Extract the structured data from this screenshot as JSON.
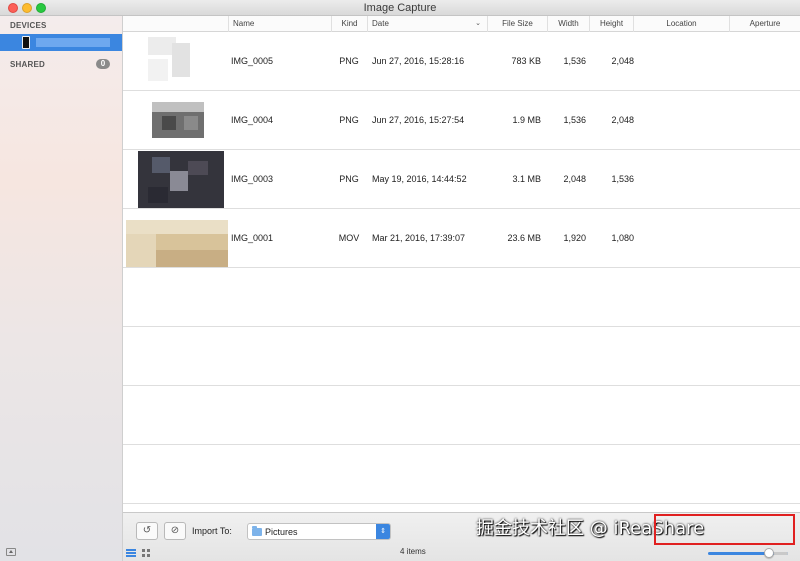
{
  "window": {
    "title": "Image Capture"
  },
  "sidebar": {
    "devices_label": "DEVICES",
    "shared_label": "SHARED",
    "shared_count": "0"
  },
  "columns": [
    "Name",
    "Kind",
    "Date",
    "File Size",
    "Width",
    "Height",
    "Location",
    "Aperture"
  ],
  "rows": [
    {
      "name": "IMG_0005",
      "kind": "PNG",
      "date": "Jun 27, 2016, 15:28:16",
      "size": "783 KB",
      "width": "1,536",
      "height": "2,048"
    },
    {
      "name": "IMG_0004",
      "kind": "PNG",
      "date": "Jun 27, 2016, 15:27:54",
      "size": "1.9 MB",
      "width": "1,536",
      "height": "2,048"
    },
    {
      "name": "IMG_0003",
      "kind": "PNG",
      "date": "May 19, 2016, 14:44:52",
      "size": "3.1 MB",
      "width": "2,048",
      "height": "1,536"
    },
    {
      "name": "IMG_0001",
      "kind": "MOV",
      "date": "Mar 21, 2016, 17:39:07",
      "size": "23.6 MB",
      "width": "1,920",
      "height": "1,080"
    }
  ],
  "toolbar": {
    "import_label": "Import To:",
    "import_value": "Pictures",
    "items_count": "4 items"
  },
  "watermark": {
    "text": "掘金技术社区 @ iReaShare"
  },
  "colors": {
    "accent": "#3b86e0",
    "highlight_box": "#e02020"
  }
}
